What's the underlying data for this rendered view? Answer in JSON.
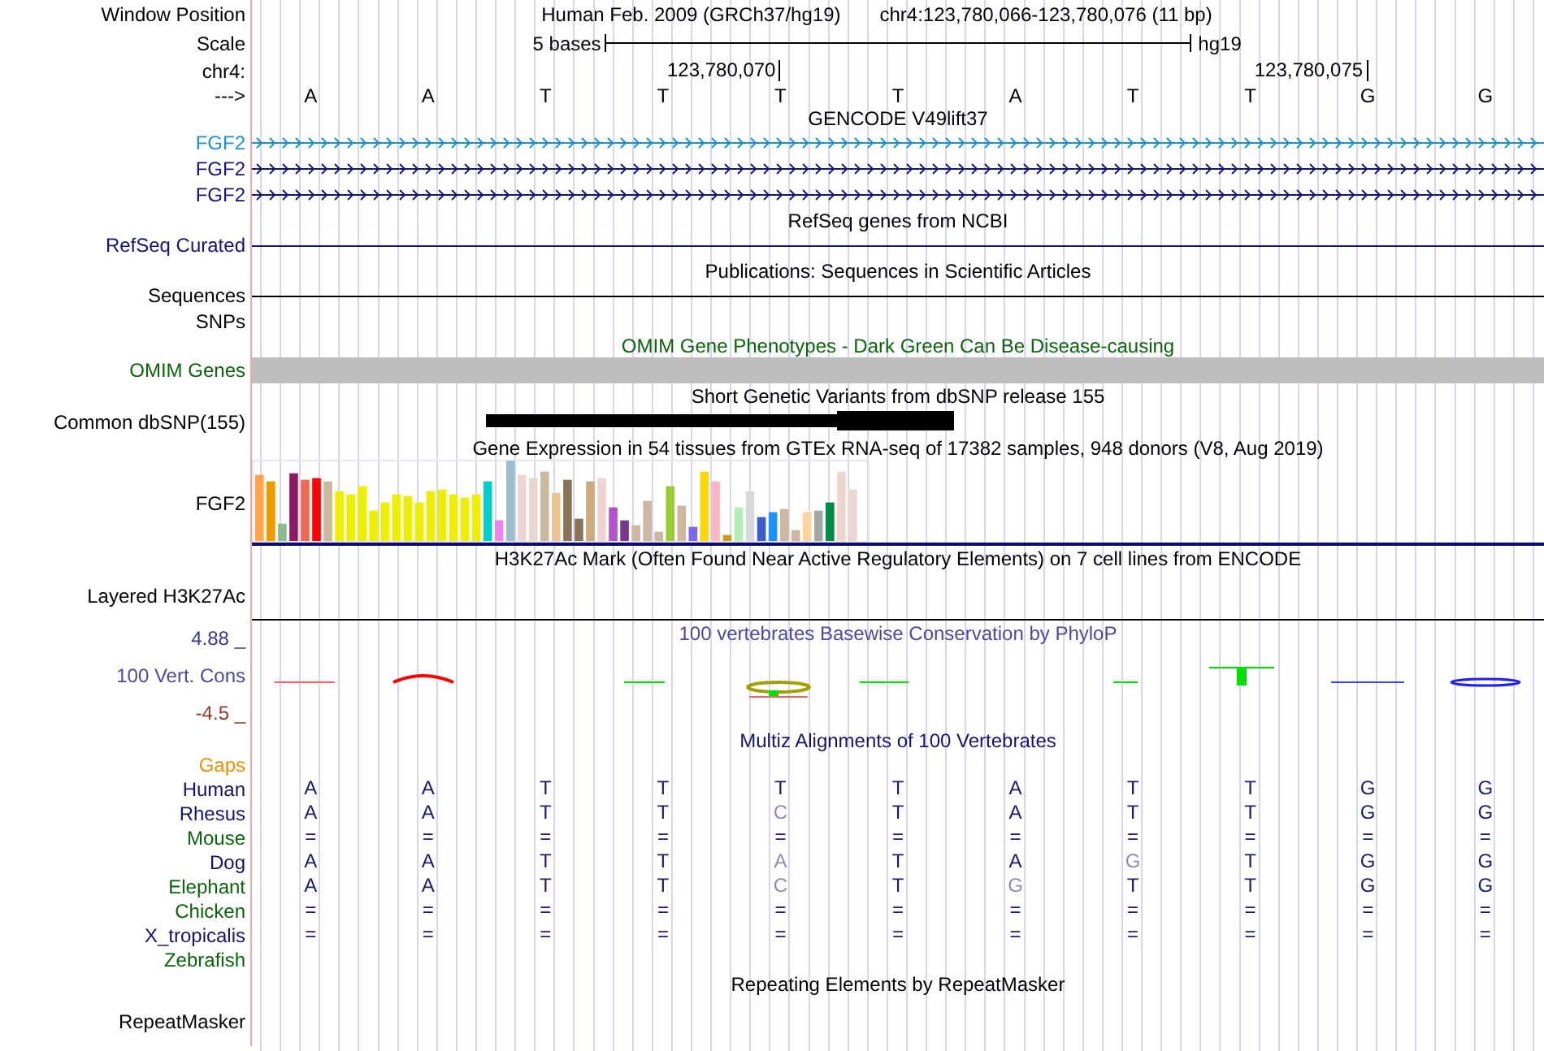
{
  "window_position": {
    "label": "Window Position",
    "assembly": "Human Feb. 2009 (GRCh37/hg19)",
    "range": "chr4:123,780,066-123,780,076 (11 bp)"
  },
  "scale": {
    "label": "Scale",
    "span": "5 bases",
    "db": "hg19"
  },
  "ruler": {
    "label": "chr4:"
  },
  "sequence": {
    "label": "--->",
    "bases": [
      {
        "base": "A"
      },
      {
        "base": "A"
      },
      {
        "base": "T"
      },
      {
        "base": "T"
      },
      {
        "base": "T",
        "tick": "123,780,070"
      },
      {
        "base": "T"
      },
      {
        "base": "A"
      },
      {
        "base": "T"
      },
      {
        "base": "T"
      },
      {
        "base": "G",
        "tick": "123,780,075"
      },
      {
        "base": "G"
      }
    ]
  },
  "tracks": [
    {
      "title": "GENCODE V49lift37",
      "color": "#000000",
      "rows": [
        {
          "kind": "arrows",
          "label": "FGF2",
          "color": "#1f8fd0"
        },
        {
          "kind": "arrows",
          "label": "FGF2",
          "color": "#14147a"
        },
        {
          "kind": "arrows",
          "label": "FGF2",
          "color": "#14147a"
        }
      ]
    },
    {
      "title": "RefSeq genes from NCBI",
      "color": "#000000",
      "rows": [
        {
          "kind": "line",
          "label": "RefSeq Curated",
          "color": "#14147a"
        }
      ]
    },
    {
      "title": "Publications: Sequences in Scientific Articles",
      "color": "#000000",
      "rows": [
        {
          "kind": "line",
          "label": "Sequences",
          "color": "#000000"
        },
        {
          "kind": "empty",
          "label": "SNPs",
          "color": "#000000"
        }
      ]
    },
    {
      "title": "OMIM Gene Phenotypes - Dark Green Can Be Disease-causing",
      "color": "#0a640a",
      "rows": [
        {
          "kind": "bar",
          "label": "OMIM Genes",
          "color": "#0a640a"
        }
      ]
    },
    {
      "title": "Short Genetic Variants from dbSNP release 155",
      "color": "#000000",
      "rows": [
        {
          "kind": "snp",
          "label": "Common dbSNP(155)",
          "color": "#000000"
        }
      ]
    },
    {
      "title": "Gene Expression in 54 tissues from GTEx RNA-seq of 17382 samples, 948 donors (V8, Aug 2019)",
      "color": "#000000",
      "rows": [
        {
          "kind": "chart",
          "label": "FGF2",
          "color": "#000000"
        }
      ]
    },
    {
      "title": "H3K27Ac Mark (Often Found Near Active Regulatory Elements) on 7 cell lines from ENCODE",
      "color": "#000000",
      "rows": [
        {
          "kind": "layered",
          "label": "Layered H3K27Ac",
          "color": "#000000"
        }
      ]
    },
    {
      "title": "100 vertebrates Basewise Conservation by PhyloP",
      "color": "#4a4aa0",
      "rows": [
        {
          "kind": "wiggle",
          "label": "100 Vert. Cons",
          "color": "#4a4aa0",
          "max": "4.88 _",
          "min": "-4.5 _"
        }
      ]
    },
    {
      "title": "Multiz Alignments of 100 Vertebrates",
      "color": "#14146e",
      "rows": [
        {
          "kind": "empty",
          "label": "Gaps",
          "color": "#e8900a"
        },
        {
          "kind": "align",
          "label": "Human",
          "color": "#14146e",
          "bases": [
            {
              "base": "A",
              "faded": false
            },
            {
              "base": "A",
              "faded": false
            },
            {
              "base": "T",
              "faded": false
            },
            {
              "base": "T",
              "faded": false
            },
            {
              "base": "T",
              "faded": false
            },
            {
              "base": "T",
              "faded": false
            },
            {
              "base": "A",
              "faded": false
            },
            {
              "base": "T",
              "faded": false
            },
            {
              "base": "T",
              "faded": false
            },
            {
              "base": "G",
              "faded": false
            },
            {
              "base": "G",
              "faded": false
            }
          ]
        },
        {
          "kind": "align",
          "label": "Rhesus",
          "color": "#14146e",
          "bases": [
            {
              "base": "A",
              "faded": false
            },
            {
              "base": "A",
              "faded": false
            },
            {
              "base": "T",
              "faded": false
            },
            {
              "base": "T",
              "faded": false
            },
            {
              "base": "C",
              "faded": true
            },
            {
              "base": "T",
              "faded": false
            },
            {
              "base": "A",
              "faded": false
            },
            {
              "base": "T",
              "faded": false
            },
            {
              "base": "T",
              "faded": false
            },
            {
              "base": "G",
              "faded": false
            },
            {
              "base": "G",
              "faded": false
            }
          ]
        },
        {
          "kind": "align",
          "label": "Mouse",
          "color": "#0a640a",
          "bases": [
            {
              "base": "=",
              "faded": false
            },
            {
              "base": "=",
              "faded": false
            },
            {
              "base": "=",
              "faded": false
            },
            {
              "base": "=",
              "faded": false
            },
            {
              "base": "=",
              "faded": false
            },
            {
              "base": "=",
              "faded": false
            },
            {
              "base": "=",
              "faded": false
            },
            {
              "base": "=",
              "faded": false
            },
            {
              "base": "=",
              "faded": false
            },
            {
              "base": "=",
              "faded": false
            },
            {
              "base": "=",
              "faded": false
            }
          ]
        },
        {
          "kind": "align",
          "label": "Dog",
          "color": "#14146e",
          "bases": [
            {
              "base": "A",
              "faded": false
            },
            {
              "base": "A",
              "faded": false
            },
            {
              "base": "T",
              "faded": false
            },
            {
              "base": "T",
              "faded": false
            },
            {
              "base": "A",
              "faded": true
            },
            {
              "base": "T",
              "faded": false
            },
            {
              "base": "A",
              "faded": false
            },
            {
              "base": "G",
              "faded": true
            },
            {
              "base": "T",
              "faded": false
            },
            {
              "base": "G",
              "faded": false
            },
            {
              "base": "G",
              "faded": false
            }
          ]
        },
        {
          "kind": "align",
          "label": "Elephant",
          "color": "#0a640a",
          "bases": [
            {
              "base": "A",
              "faded": false
            },
            {
              "base": "A",
              "faded": false
            },
            {
              "base": "T",
              "faded": false
            },
            {
              "base": "T",
              "faded": false
            },
            {
              "base": "C",
              "faded": true
            },
            {
              "base": "T",
              "faded": false
            },
            {
              "base": "G",
              "faded": true
            },
            {
              "base": "T",
              "faded": false
            },
            {
              "base": "T",
              "faded": false
            },
            {
              "base": "G",
              "faded": false
            },
            {
              "base": "G",
              "faded": false
            }
          ]
        },
        {
          "kind": "align",
          "label": "Chicken",
          "color": "#0a640a",
          "bases": [
            {
              "base": "=",
              "faded": false
            },
            {
              "base": "=",
              "faded": false
            },
            {
              "base": "=",
              "faded": false
            },
            {
              "base": "=",
              "faded": false
            },
            {
              "base": "=",
              "faded": false
            },
            {
              "base": "=",
              "faded": false
            },
            {
              "base": "=",
              "faded": false
            },
            {
              "base": "=",
              "faded": false
            },
            {
              "base": "=",
              "faded": false
            },
            {
              "base": "=",
              "faded": false
            },
            {
              "base": "=",
              "faded": false
            }
          ]
        },
        {
          "kind": "align",
          "label": "X_tropicalis",
          "color": "#14146e",
          "bases": [
            {
              "base": "=",
              "faded": false
            },
            {
              "base": "=",
              "faded": false
            },
            {
              "base": "=",
              "faded": false
            },
            {
              "base": "=",
              "faded": false
            },
            {
              "base": "=",
              "faded": false
            },
            {
              "base": "=",
              "faded": false
            },
            {
              "base": "=",
              "faded": false
            },
            {
              "base": "=",
              "faded": false
            },
            {
              "base": "=",
              "faded": false
            },
            {
              "base": "=",
              "faded": false
            },
            {
              "base": "=",
              "faded": false
            }
          ]
        },
        {
          "kind": "empty",
          "label": "Zebrafish",
          "color": "#0a640a"
        }
      ]
    },
    {
      "title": "Repeating Elements by RepeatMasker",
      "color": "#000000",
      "rows": [
        {
          "kind": "repeat",
          "label": "RepeatMasker",
          "color": "#000000"
        }
      ]
    }
  ]
}
